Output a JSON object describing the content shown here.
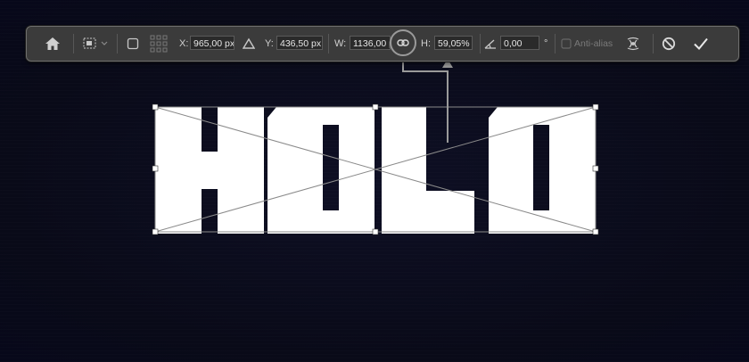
{
  "toolbar": {
    "x_label": "X:",
    "x_value": "965,00 px",
    "y_label": "Y:",
    "y_value": "436,50 px",
    "w_label": "W:",
    "w_value": "1136,00 p",
    "h_label": "H:",
    "h_value": "59,05%",
    "angle_value": "0,00",
    "degree_symbol": "°",
    "antialias_label": "Anti-alias"
  },
  "canvas": {
    "text": "HOLO"
  },
  "colors": {
    "background": "#0b0b1c",
    "bar": "#3b3b3b",
    "artwork": "#ffffff"
  }
}
